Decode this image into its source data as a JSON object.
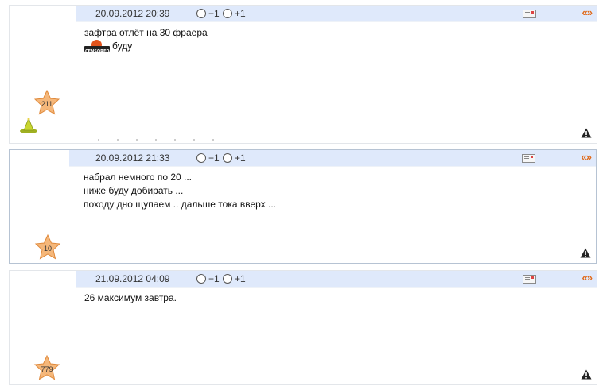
{
  "posts": [
    {
      "date": "20.09.2012 20:39",
      "vote_minus": "−1",
      "vote_plus": "+1",
      "quote_label": "«»",
      "lines": [
        "зафтра отлёт на 30 фраера",
        "буду"
      ],
      "star_count": "211",
      "has_censored_icon": true,
      "has_hat_icon": true
    },
    {
      "date": "20.09.2012 21:33",
      "vote_minus": "−1",
      "vote_plus": "+1",
      "quote_label": "«»",
      "lines": [
        "набрал немного по 20 ...",
        "ниже буду добирать ...",
        "походу дно щупаем .. дальше тока вверх ..."
      ],
      "star_count": "10"
    },
    {
      "date": "21.09.2012 04:09",
      "vote_minus": "−1",
      "vote_plus": "+1",
      "quote_label": "«»",
      "lines": [
        "26 максимум завтра."
      ],
      "star_count": "779"
    }
  ],
  "colors": {
    "header_bg": "#dfe9fb",
    "quote": "#e06a1a",
    "star_fill": "#f5b77a",
    "selected_border": "#b6c3d3"
  },
  "icons": [
    "radio-icon",
    "private-message-icon",
    "quote-icon",
    "star-rating-icon",
    "report-warning-icon",
    "censored-icon",
    "wizard-hat-icon"
  ]
}
